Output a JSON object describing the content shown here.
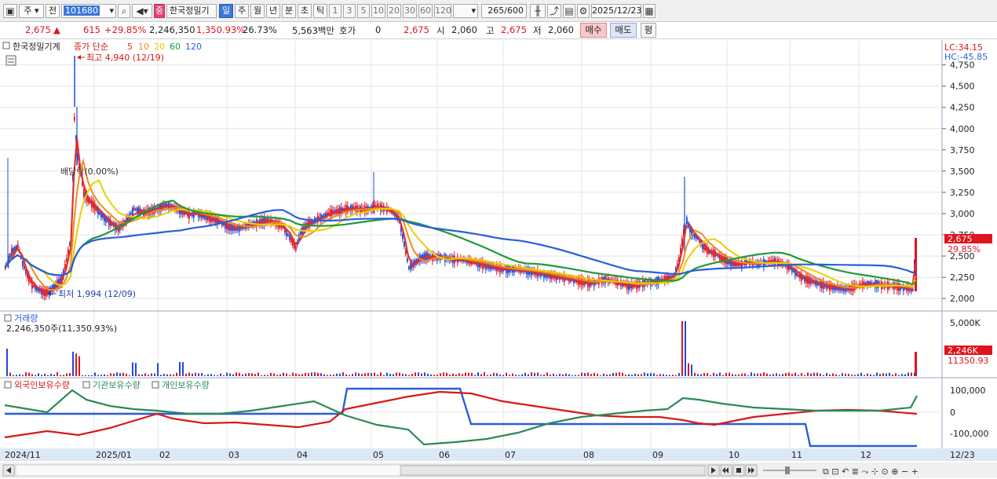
{
  "toolbar": {
    "menu_icon": "window-icon",
    "type_label": "주",
    "prev_label": "전",
    "stock_code": "101680",
    "stock_name": "한국정밀기",
    "badge_label": "중",
    "periods": [
      "일",
      "주",
      "월",
      "년",
      "분",
      "초",
      "틱"
    ],
    "selected_period": "일",
    "intervals": [
      "1",
      "3",
      "5",
      "10",
      "20",
      "30",
      "60",
      "120"
    ],
    "count_value": "265",
    "count_total": "/600",
    "date_value": "2025/12/23"
  },
  "quote": {
    "price": "2,675",
    "change": "615",
    "change_pct": "+29.85%",
    "volume": "2,246,350",
    "volume_pct": "1,350.93%",
    "turnover_pct": "26.73%",
    "amount": "5,563백만",
    "hoga_label": "호가",
    "hoga_value": "0",
    "current": "2,675",
    "open_label": "시",
    "open_value": "2,060",
    "high_label": "고",
    "high_value": "2,675",
    "low_label": "저",
    "low_value": "2,060",
    "buy_label": "매수",
    "sell_label": "매도",
    "avg_label": "평"
  },
  "chart_data": [
    {
      "type": "candlestick",
      "title": "한국정밀기계",
      "legend": [
        {
          "name": "종가 단순",
          "color": "#c82020"
        },
        {
          "name": "5",
          "color": "#e03030"
        },
        {
          "name": "10",
          "color": "#f08c1e"
        },
        {
          "name": "20",
          "color": "#e8d000"
        },
        {
          "name": "60",
          "color": "#1f9a3a"
        },
        {
          "name": "120",
          "color": "#2a5fd8"
        }
      ],
      "ylim": [
        1900,
        4950
      ],
      "yticks": [
        "4,750",
        "4,500",
        "4,250",
        "4,000",
        "3,750",
        "3,500",
        "3,250",
        "3,000",
        "2,750",
        "2,500",
        "2,250",
        "2,000"
      ],
      "x_labels": [
        "2024/11",
        "2025/01",
        "02",
        "03",
        "04",
        "05",
        "06",
        "07",
        "08",
        "09",
        "10",
        "11",
        "12",
        "12/23"
      ],
      "annotations": {
        "high": "최고 4,940 (12/19)",
        "low": "최저 1,994 (12/09)",
        "event": "배당락(0.00%)",
        "lc": "LC:34.15",
        "hc": "HC:-45.85",
        "last_price": "2,675",
        "last_pct": "29.85%"
      },
      "close_path": [
        [
          "2024-11",
          2400
        ],
        [
          "2024-12-09",
          2010
        ],
        [
          "2024-12-16",
          2300
        ],
        [
          "2024-12-19",
          4940
        ],
        [
          "2024-12-24",
          3650
        ],
        [
          "2025-01",
          2950
        ],
        [
          "2025-02",
          3150
        ],
        [
          "2025-03",
          2850
        ],
        [
          "2025-04",
          2650
        ],
        [
          "2025-04-20",
          3050
        ],
        [
          "2025-05",
          3100
        ],
        [
          "2025-05-15",
          2400
        ],
        [
          "2025-06",
          2520
        ],
        [
          "2025-07",
          2330
        ],
        [
          "2025-08",
          2200
        ],
        [
          "2025-09",
          2180
        ],
        [
          "2025-09-15",
          3450
        ],
        [
          "2025-09-25",
          2650
        ],
        [
          "2025-10",
          2430
        ],
        [
          "2025-11",
          2230
        ],
        [
          "2025-12",
          2120
        ],
        [
          "2025-12-22",
          2060
        ],
        [
          "2025-12-23",
          2675
        ]
      ]
    },
    {
      "type": "bar",
      "title": "거래량",
      "info": "2,246,350주(11,350.93%)",
      "yticks": [
        "5,000K"
      ],
      "last_label": "2,246K",
      "last_pct": "11350.93"
    },
    {
      "type": "line",
      "series": [
        {
          "name": "외국인보유수량",
          "color": "#d81818"
        },
        {
          "name": "기관보유수량",
          "color": "#2a8a55"
        },
        {
          "name": "개인보유수량",
          "color": "#2a5fd8"
        }
      ],
      "yticks": [
        "100,000",
        "0",
        "-100,000"
      ]
    }
  ],
  "colors": {
    "up": "#e0141e",
    "down": "#1f49d8",
    "axis_bg": "#dce8f6",
    "grid": "#e4e4e4"
  },
  "bottom": {
    "nav_icons": [
      "play-icon",
      "rewind-icon",
      "stop-icon",
      "fast-forward-icon"
    ]
  }
}
